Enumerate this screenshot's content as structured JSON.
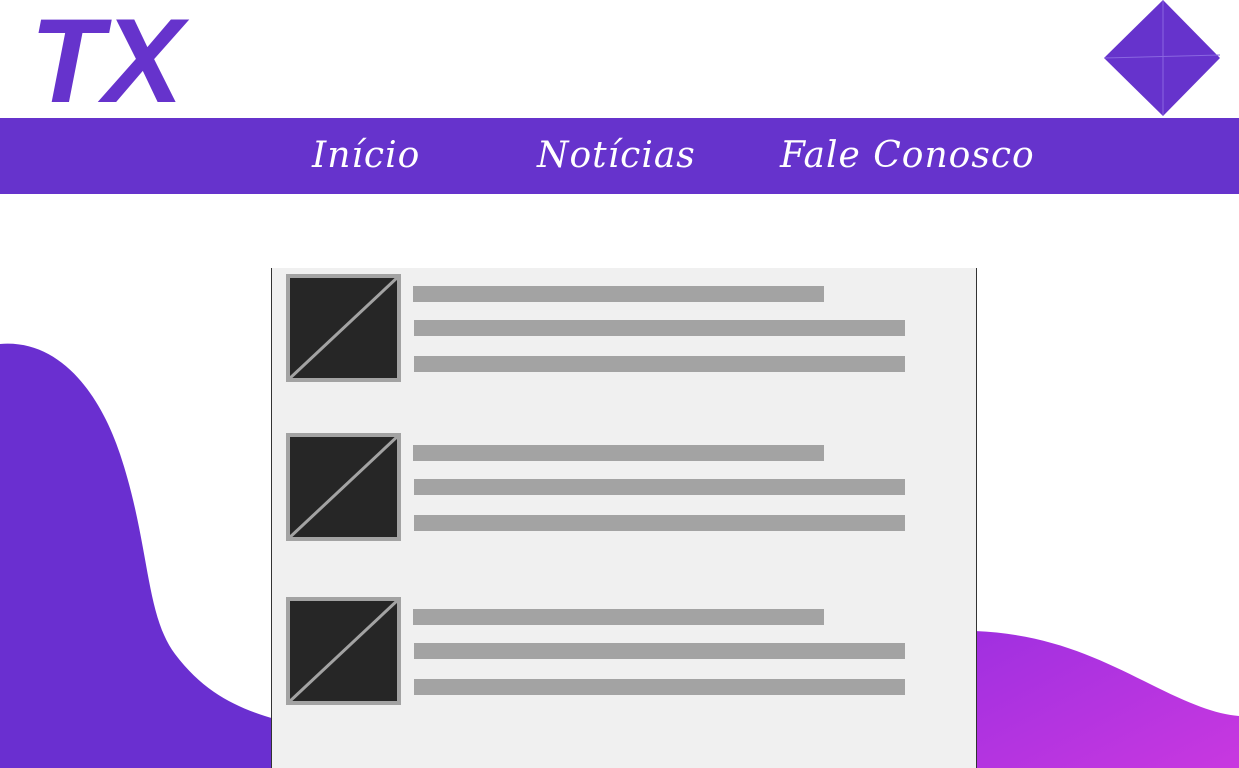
{
  "header": {
    "logo_text": "TX",
    "logo_icon": "tx-logo",
    "corner_icon": "diamond-icon"
  },
  "nav": {
    "items": [
      {
        "label": "Início"
      },
      {
        "label": "Notícias"
      },
      {
        "label": "Fale Conosco"
      }
    ]
  },
  "news": {
    "items": [
      {
        "thumbnail": "image-placeholder-icon"
      },
      {
        "thumbnail": "image-placeholder-icon"
      },
      {
        "thumbnail": "image-placeholder-icon"
      }
    ]
  },
  "colors": {
    "brand": "#6633cc",
    "blob_left": "#6a2fd0",
    "blob_right": "#c030e0",
    "panel": "#f0f0f0",
    "placeholder_line": "#a3a3a3",
    "thumbnail": "#262626"
  }
}
